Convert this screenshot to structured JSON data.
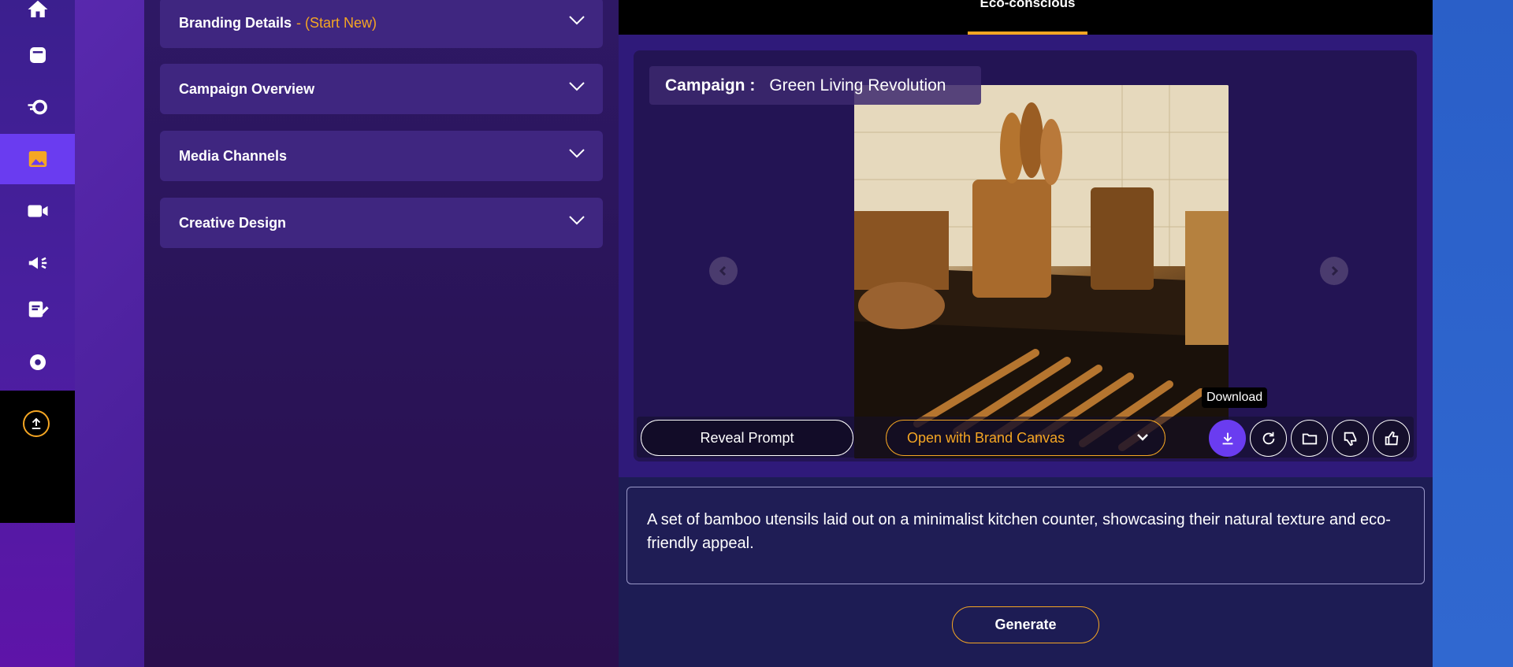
{
  "sidebar": {
    "items": [
      {
        "icon": "home-icon"
      },
      {
        "icon": "library-icon"
      },
      {
        "icon": "automation-icon"
      },
      {
        "icon": "image-icon",
        "active": true
      },
      {
        "icon": "video-icon"
      },
      {
        "icon": "megaphone-icon"
      },
      {
        "icon": "content-writer-icon"
      },
      {
        "icon": "gear-icon"
      }
    ],
    "upload_icon": "upload-icon"
  },
  "accordion": [
    {
      "title": "Branding Details",
      "suffix": " - (Start New)"
    },
    {
      "title": "Campaign Overview",
      "suffix": ""
    },
    {
      "title": "Media Channels",
      "suffix": ""
    },
    {
      "title": "Creative Design",
      "suffix": ""
    }
  ],
  "tabs": {
    "active_label": "Eco-conscious"
  },
  "viewer": {
    "campaign_label": "Campaign :",
    "campaign_name": "Green Living Revolution",
    "reveal_prompt_label": "Reveal Prompt",
    "canvas_select_label": "Open with Brand Canvas",
    "tooltip": "Download",
    "actions": [
      "download-icon",
      "refresh-icon",
      "folder-icon",
      "thumbs-down-icon",
      "thumbs-up-icon"
    ]
  },
  "prompt": {
    "text": "A set of bamboo utensils laid out on a minimalist kitchen counter, showcasing their natural texture and eco-friendly appeal."
  },
  "generate_label": "Generate",
  "colors": {
    "accent": "#f5a623",
    "primary": "#6a3cf0"
  }
}
